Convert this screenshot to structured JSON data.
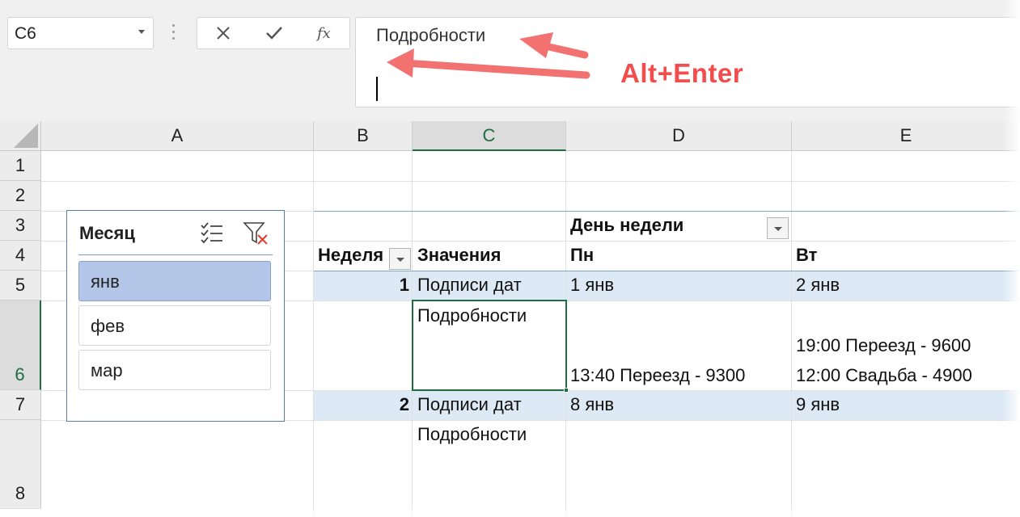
{
  "name_box": {
    "value": "C6"
  },
  "formula_bar": {
    "content": "Подробности"
  },
  "annotation": {
    "text": "Alt+Enter",
    "color": "#f24c4c"
  },
  "columns": [
    "A",
    "B",
    "C",
    "D",
    "E"
  ],
  "rows": [
    "1",
    "2",
    "3",
    "4",
    "5",
    "6",
    "7",
    "8"
  ],
  "pivot": {
    "col_field": "День недели",
    "row_field": "Неделя",
    "values_label": "Значения",
    "days": [
      "Пн",
      "Вт"
    ],
    "weeks": [
      {
        "week": "1",
        "label_dates": "Подписи дат",
        "label_details": "Подробности",
        "mon_date": "1 янв",
        "tue_date": "2 янв",
        "mon_details": [
          "13:40 Переезд - 9300"
        ],
        "tue_details": [
          "19:00 Переезд - 9600",
          "12:00 Свадьба - 4900"
        ]
      },
      {
        "week": "2",
        "label_dates": "Подписи дат",
        "label_details": "Подробности",
        "mon_date": "8 янв",
        "tue_date": "9 янв"
      }
    ]
  },
  "slicer": {
    "title": "Месяц",
    "items": [
      {
        "label": "янв",
        "selected": true
      },
      {
        "label": "фев",
        "selected": false
      },
      {
        "label": "мар",
        "selected": false
      }
    ]
  },
  "colors": {
    "accent": "#1e6d41",
    "band": "#dde9f4",
    "slicer_selected": "#b4c6e7"
  }
}
